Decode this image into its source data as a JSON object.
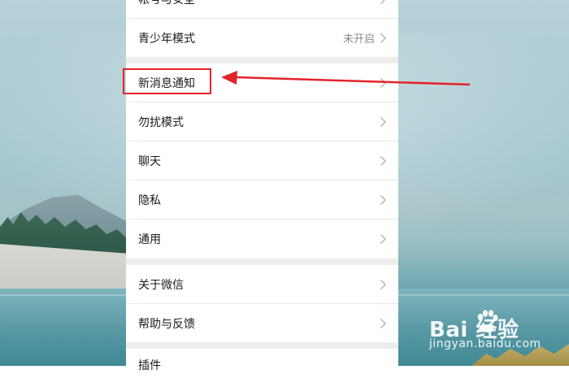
{
  "settings": {
    "items": [
      {
        "label": "帐号与安全",
        "value": ""
      },
      {
        "label": "青少年模式",
        "value": "未开启"
      },
      {
        "label": "新消息通知",
        "value": ""
      },
      {
        "label": "勿扰模式",
        "value": ""
      },
      {
        "label": "聊天",
        "value": ""
      },
      {
        "label": "隐私",
        "value": ""
      },
      {
        "label": "通用",
        "value": ""
      },
      {
        "label": "关于微信",
        "value": ""
      },
      {
        "label": "帮助与反馈",
        "value": ""
      },
      {
        "label": "插件",
        "value": ""
      }
    ]
  },
  "annotation": {
    "highlight_color": "#e2242a",
    "target_item": "新消息通知"
  },
  "watermark": {
    "logo_text": "Bai  经验",
    "url": "jingyan.baidu.com"
  },
  "colors": {
    "panel_bg": "#ededed",
    "row_bg": "#ffffff",
    "text": "#1a1a1a",
    "secondary_text": "#8a8a8a",
    "chevron": "#b2b2b2"
  }
}
